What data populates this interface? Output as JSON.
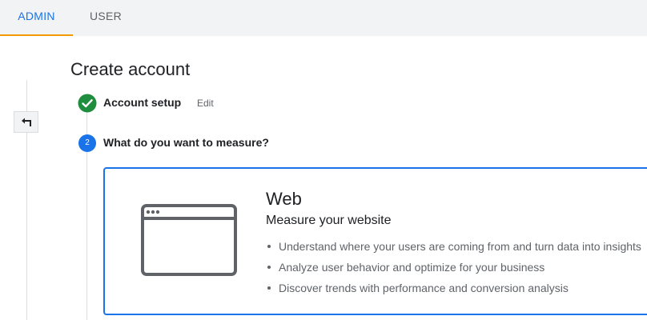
{
  "tabs": [
    {
      "label": "ADMIN",
      "active": true
    },
    {
      "label": "USER",
      "active": false
    }
  ],
  "page": {
    "title": "Create account",
    "back_icon": "back-arrow-icon"
  },
  "steps": [
    {
      "label": "Account setup",
      "status": "done",
      "icon": "check-circle-icon",
      "action_label": "Edit"
    },
    {
      "number": "2",
      "label": "What do you want to measure?",
      "status": "current"
    }
  ],
  "option_card": {
    "icon": "browser-window-icon",
    "title": "Web",
    "subtitle": "Measure your website",
    "bullets": [
      "Understand where your users are coming from and turn data into insights",
      "Analyze user behavior and optimize for your business",
      "Discover trends with performance and conversion analysis"
    ],
    "selected": true
  },
  "colors": {
    "accent": "#1a73e8",
    "tab_indicator": "#f29900",
    "success": "#1e8e3e",
    "topbar_bg": "#f1f3f4"
  }
}
